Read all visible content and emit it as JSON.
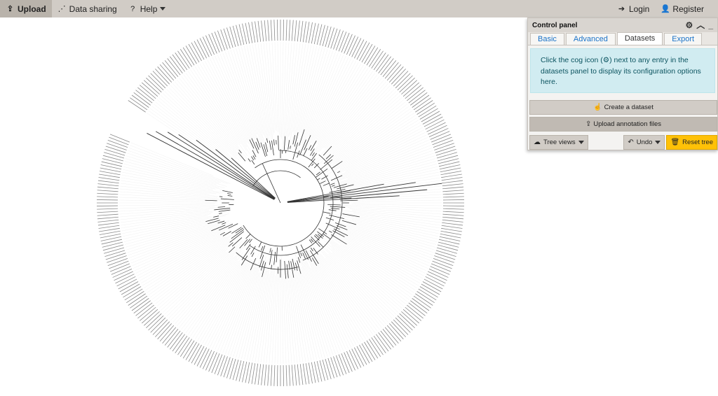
{
  "navbar": {
    "upload": "Upload",
    "data_sharing": "Data sharing",
    "help": "Help",
    "login": "Login",
    "register": "Register"
  },
  "control_panel": {
    "title": "Control panel",
    "tabs": [
      {
        "label": "Basic",
        "active": false
      },
      {
        "label": "Advanced",
        "active": false
      },
      {
        "label": "Datasets",
        "active": true
      },
      {
        "label": "Export",
        "active": false
      }
    ],
    "info_text": {
      "line1": "Click the cog icon (",
      "line1b": ") next to any entry in the",
      "line2": "datasets panel to display its configuration options",
      "line3": "here."
    },
    "create_dataset": "Create a dataset",
    "upload_annotations": "Upload annotation files",
    "tree_views": "Tree views",
    "undo": "Undo",
    "reset_tree": "Reset tree"
  },
  "colors": {
    "navbar": "#d1ccc6",
    "alert_bg": "#d1ecf1",
    "alert_text": "#0c5460",
    "tab_link": "#1a73c8",
    "reset_button": "#ffc107",
    "tree_line": "#333333"
  },
  "icons": [
    "upload-icon",
    "share-icon",
    "help-icon",
    "login-icon",
    "user-plus-icon",
    "gear-icon",
    "chevron-up-icon",
    "minimize-icon",
    "cog-icon",
    "hand-icon",
    "cloud-icon",
    "undo-icon",
    "trash-icon"
  ]
}
